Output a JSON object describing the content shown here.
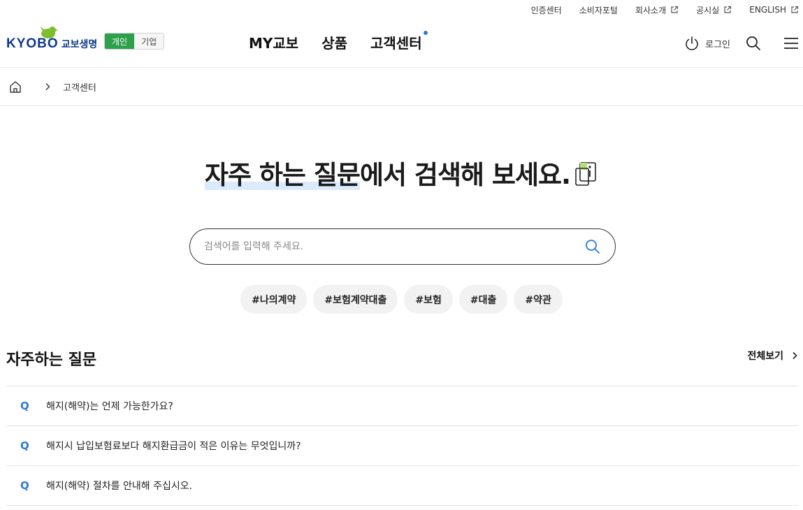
{
  "util_links": [
    {
      "label": "인증센터",
      "external": false
    },
    {
      "label": "소비자포털",
      "external": false
    },
    {
      "label": "회사소개",
      "external": true
    },
    {
      "label": "공시실",
      "external": true
    },
    {
      "label": "ENGLISH",
      "external": true
    }
  ],
  "logo": {
    "en": "KYOBO",
    "kr": "교보생명"
  },
  "segment": {
    "personal": "개인",
    "corporate": "기업",
    "active": "personal"
  },
  "gnb": [
    "MY교보",
    "상품",
    "고객센터"
  ],
  "header": {
    "login_label": "로그인"
  },
  "breadcrumb": {
    "current": "고객센터"
  },
  "hero": {
    "title_highlight": "자주 하는 질문",
    "title_rest": "에서 검색해 보세요."
  },
  "search": {
    "placeholder": "검색어를 입력해 주세요.",
    "value": ""
  },
  "tags": [
    "#나의계약",
    "#보험계약대출",
    "#보험",
    "#대출",
    "#약관"
  ],
  "faq": {
    "title": "자주하는 질문",
    "view_all": "전체보기",
    "q_marker": "Q",
    "items": [
      "해지(해약)는 언제 가능한가요?",
      "해지시 납입보험료보다 해지환급금이 적은 이유는 무엇입니까?",
      "해지(해약) 절차를 안내해 주십시오."
    ]
  },
  "colors": {
    "brand_green": "#2ca04a",
    "brand_navy": "#0e3a8a",
    "accent_blue": "#2a7bd8",
    "highlight": "#dbeafc"
  }
}
